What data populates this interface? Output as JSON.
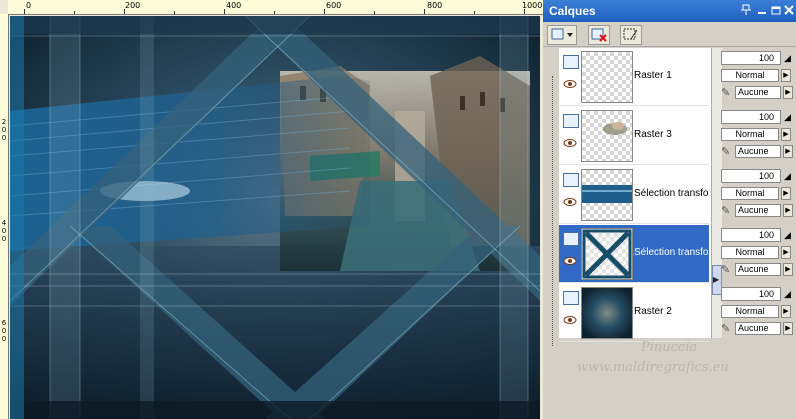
{
  "rulers": {
    "top_labels": [
      "0",
      "200",
      "400",
      "600",
      "800",
      "1000"
    ],
    "left_labels": [
      "2\n0\n0",
      "4\n0\n0",
      "6\n0\n0"
    ]
  },
  "palette": {
    "title": "Calques",
    "title_buttons": [
      "pin-icon",
      "minimize-icon",
      "restore-icon",
      "close-icon"
    ],
    "layers": [
      {
        "name": "Raster 1",
        "opacity": "100",
        "blend": "Normal",
        "mask": "Aucune",
        "selected": false
      },
      {
        "name": "Raster 3",
        "opacity": "100",
        "blend": "Normal",
        "mask": "Aucune",
        "selected": false
      },
      {
        "name": "Sélection transformée",
        "opacity": "100",
        "blend": "Normal",
        "mask": "Aucune",
        "selected": false
      },
      {
        "name": "Sélection transformée",
        "opacity": "100",
        "blend": "Normal",
        "mask": "Aucune",
        "selected": true
      },
      {
        "name": "Raster 2",
        "opacity": "100",
        "blend": "Normal",
        "mask": "Aucune",
        "selected": false
      }
    ]
  },
  "watermark": {
    "line1": "Pinuccia",
    "line2": "www.maldiregrafics.eu"
  },
  "colors": {
    "titlebar": "#2a6fd0",
    "selection": "#316ac5",
    "panel": "#d4d0c8",
    "ruler": "#fdfcd8"
  }
}
